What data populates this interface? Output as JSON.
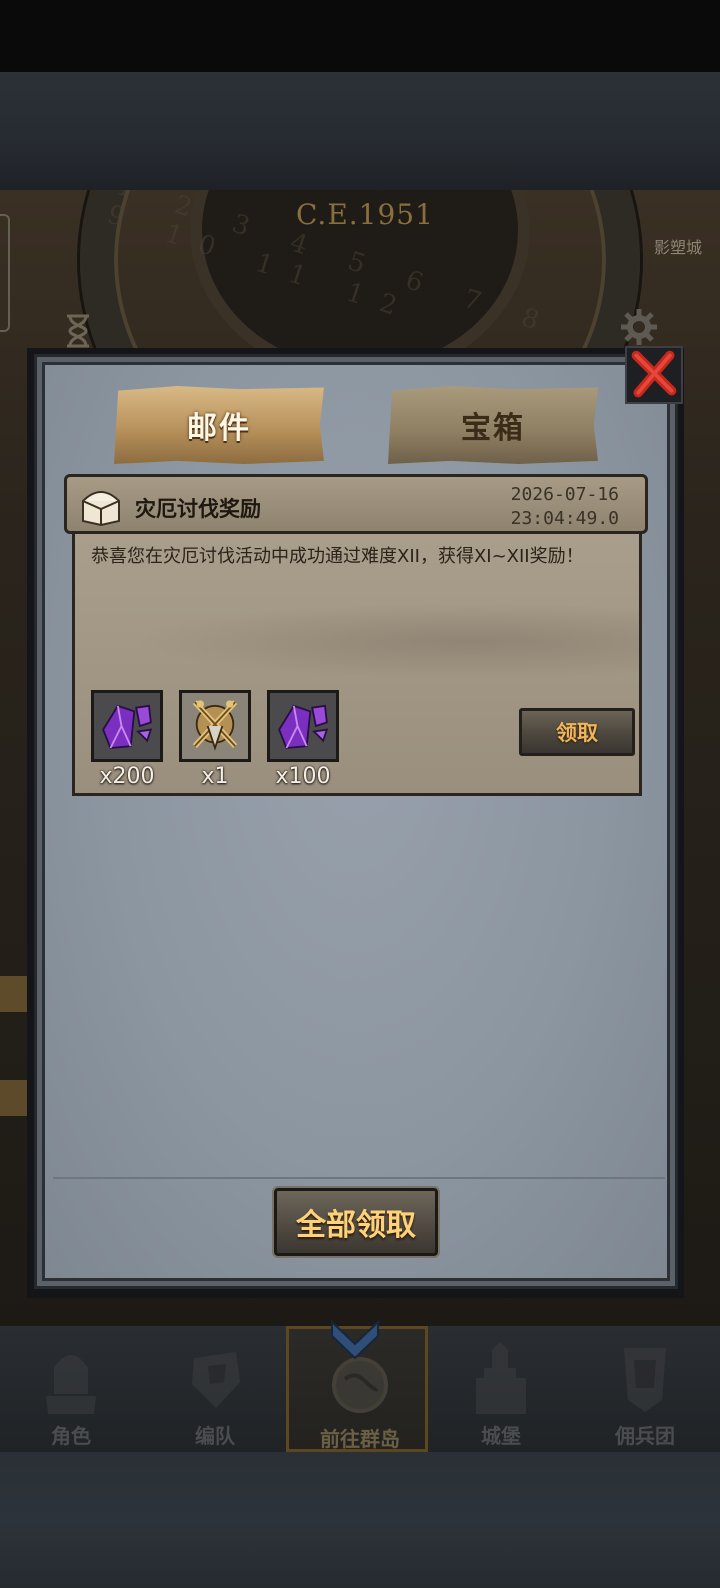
{
  "background": {
    "era_text": "C.E.1951",
    "dial_numbers": "1 2 3 4 5 6 7 8 9 10 11 12",
    "side_label": "影塑城"
  },
  "dialog": {
    "tabs": [
      {
        "label": "邮件",
        "active": true
      },
      {
        "label": "宝箱",
        "active": false
      }
    ],
    "close_icon": "close-x-icon",
    "mail": {
      "icon": "treasure-chest-icon",
      "title": "灾厄讨伐奖励",
      "date": "2026-07-16",
      "time": "23:04:49.0",
      "body": "恭喜您在灾厄讨伐活动中成功通过难度XII，获得XI~XII奖励！",
      "rewards": [
        {
          "icon": "purple-crystal-icon",
          "count": "x200"
        },
        {
          "icon": "golden-crest-emblem-icon",
          "count": "x1"
        },
        {
          "icon": "purple-crystal-icon",
          "count": "x100"
        }
      ],
      "claim_label": "领取"
    },
    "claim_all_label": "全部领取"
  },
  "bottom_nav": [
    {
      "label": "角色",
      "icon": "knight-helmet-icon",
      "active": false
    },
    {
      "label": "编队",
      "icon": "armored-warrior-icon",
      "active": false
    },
    {
      "label": "前往群岛",
      "icon": "globe-compass-icon",
      "active": true
    },
    {
      "label": "城堡",
      "icon": "castle-icon",
      "active": false
    },
    {
      "label": "佣兵团",
      "icon": "mercenary-banner-icon",
      "active": false
    }
  ],
  "colors": {
    "panel": "#8c96a0",
    "tab_active": "#b8925c",
    "claim_text": "#f0b65a",
    "claim_all_text": "#ffd27a",
    "crystal": "#8a3fc8"
  }
}
